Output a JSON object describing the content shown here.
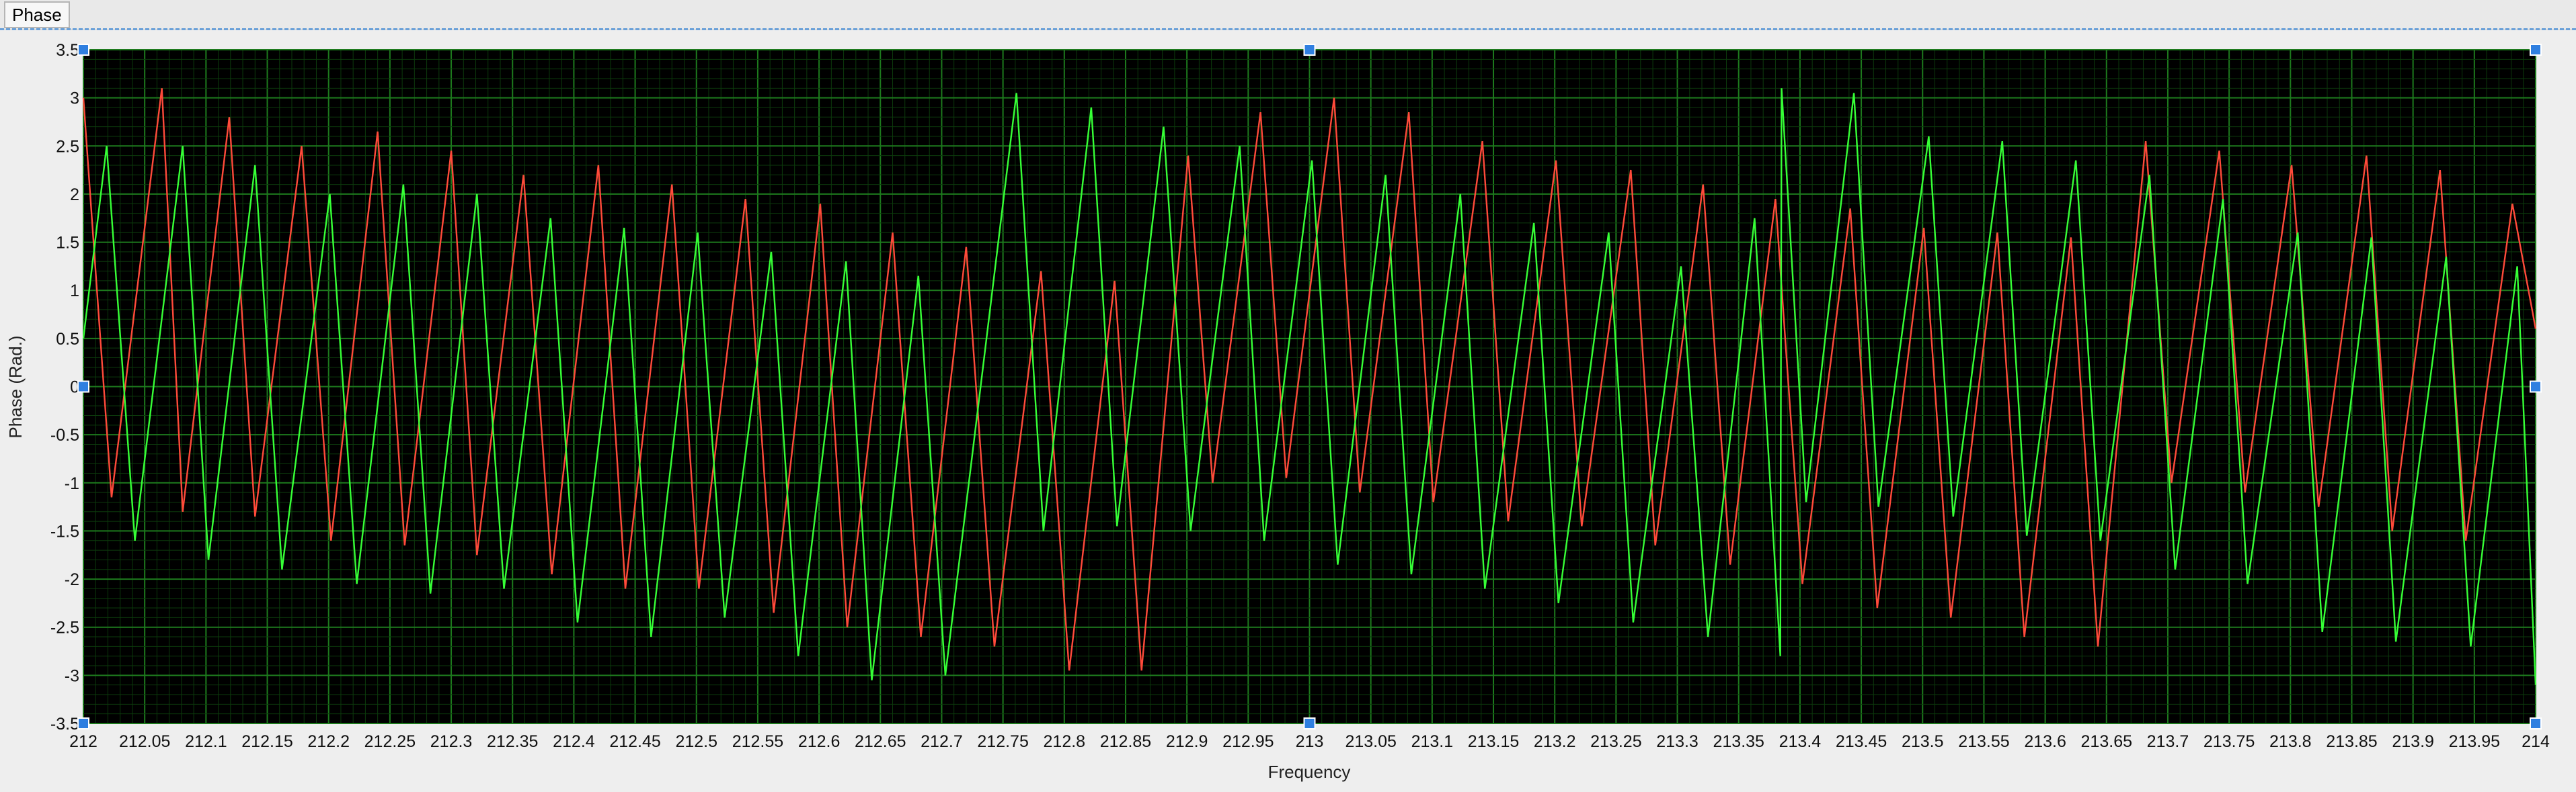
{
  "window": {
    "tab_label": "Phase"
  },
  "colors": {
    "plot_background": "#000000",
    "grid_major": "#1d7a1d",
    "grid_minor": "#0c3a0c"
  },
  "chart_data": {
    "type": "line",
    "title": "",
    "xlabel": "Frequency",
    "ylabel": "Phase (Rad.)",
    "xlim": [
      212,
      214
    ],
    "ylim": [
      -3.5,
      3.5
    ],
    "grid": true,
    "x_ticks": [
      "212",
      "212.05",
      "212.1",
      "212.15",
      "212.2",
      "212.25",
      "212.3",
      "212.35",
      "212.4",
      "212.45",
      "212.5",
      "212.55",
      "212.6",
      "212.65",
      "212.7",
      "212.75",
      "212.8",
      "212.85",
      "212.9",
      "212.95",
      "213",
      "213.05",
      "213.1",
      "213.15",
      "213.2",
      "213.25",
      "213.3",
      "213.35",
      "213.4",
      "213.45",
      "213.5",
      "213.55",
      "213.6",
      "213.65",
      "213.7",
      "213.75",
      "213.8",
      "213.85",
      "213.9",
      "213.95",
      "214"
    ],
    "y_ticks": [
      "3.5",
      "3",
      "2.5",
      "2",
      "1.5",
      "1",
      "0.5",
      "0",
      "-0.5",
      "-1",
      "-1.5",
      "-2",
      "-2.5",
      "-3",
      "-3.5"
    ],
    "series": [
      {
        "color": "#ff4a3a",
        "points": [
          [
            212.0,
            3.0
          ],
          [
            212.023,
            -1.15
          ],
          [
            212.064,
            3.1
          ],
          [
            212.081,
            -1.3
          ],
          [
            212.119,
            2.8
          ],
          [
            212.14,
            -1.35
          ],
          [
            212.178,
            2.5
          ],
          [
            212.202,
            -1.6
          ],
          [
            212.24,
            2.65
          ],
          [
            212.262,
            -1.65
          ],
          [
            212.3,
            2.45
          ],
          [
            212.321,
            -1.75
          ],
          [
            212.359,
            2.2
          ],
          [
            212.382,
            -1.95
          ],
          [
            212.42,
            2.3
          ],
          [
            212.442,
            -2.1
          ],
          [
            212.48,
            2.1
          ],
          [
            212.502,
            -2.1
          ],
          [
            212.54,
            1.95
          ],
          [
            212.563,
            -2.35
          ],
          [
            212.601,
            1.9
          ],
          [
            212.623,
            -2.5
          ],
          [
            212.66,
            1.6
          ],
          [
            212.683,
            -2.6
          ],
          [
            212.72,
            1.45
          ],
          [
            212.743,
            -2.7
          ],
          [
            212.781,
            1.2
          ],
          [
            212.804,
            -2.95
          ],
          [
            212.841,
            1.1
          ],
          [
            212.863,
            -2.95
          ],
          [
            212.901,
            2.4
          ],
          [
            212.921,
            -1.0
          ],
          [
            212.96,
            2.85
          ],
          [
            212.981,
            -0.95
          ],
          [
            213.02,
            3.0
          ],
          [
            213.041,
            -1.1
          ],
          [
            213.081,
            2.85
          ],
          [
            213.101,
            -1.2
          ],
          [
            213.141,
            2.55
          ],
          [
            213.162,
            -1.4
          ],
          [
            213.201,
            2.35
          ],
          [
            213.222,
            -1.45
          ],
          [
            213.262,
            2.25
          ],
          [
            213.282,
            -1.65
          ],
          [
            213.321,
            2.1
          ],
          [
            213.343,
            -1.85
          ],
          [
            213.38,
            1.95
          ],
          [
            213.402,
            -2.05
          ],
          [
            213.441,
            1.85
          ],
          [
            213.463,
            -2.3
          ],
          [
            213.501,
            1.65
          ],
          [
            213.523,
            -2.4
          ],
          [
            213.561,
            1.6
          ],
          [
            213.583,
            -2.6
          ],
          [
            213.621,
            1.55
          ],
          [
            213.643,
            -2.7
          ],
          [
            213.682,
            2.55
          ],
          [
            213.703,
            -1.0
          ],
          [
            213.742,
            2.45
          ],
          [
            213.763,
            -1.1
          ],
          [
            213.801,
            2.3
          ],
          [
            213.823,
            -1.25
          ],
          [
            213.862,
            2.4
          ],
          [
            213.883,
            -1.5
          ],
          [
            213.922,
            2.25
          ],
          [
            213.943,
            -1.6
          ],
          [
            213.981,
            1.9
          ],
          [
            214.0,
            0.6
          ]
        ]
      },
      {
        "color": "#36ff36",
        "points": [
          [
            212.0,
            0.5
          ],
          [
            212.019,
            2.5
          ],
          [
            212.042,
            -1.6
          ],
          [
            212.081,
            2.5
          ],
          [
            212.102,
            -1.8
          ],
          [
            212.14,
            2.3
          ],
          [
            212.162,
            -1.9
          ],
          [
            212.201,
            2.0
          ],
          [
            212.223,
            -2.05
          ],
          [
            212.261,
            2.1
          ],
          [
            212.283,
            -2.15
          ],
          [
            212.321,
            2.0
          ],
          [
            212.343,
            -2.1
          ],
          [
            212.381,
            1.75
          ],
          [
            212.403,
            -2.45
          ],
          [
            212.441,
            1.65
          ],
          [
            212.463,
            -2.6
          ],
          [
            212.501,
            1.6
          ],
          [
            212.523,
            -2.4
          ],
          [
            212.561,
            1.4
          ],
          [
            212.583,
            -2.8
          ],
          [
            212.622,
            1.3
          ],
          [
            212.643,
            -3.05
          ],
          [
            212.681,
            1.15
          ],
          [
            212.703,
            -3.0
          ],
          [
            212.761,
            3.05
          ],
          [
            212.783,
            -1.5
          ],
          [
            212.822,
            2.9
          ],
          [
            212.843,
            -1.45
          ],
          [
            212.881,
            2.7
          ],
          [
            212.903,
            -1.5
          ],
          [
            212.943,
            2.5
          ],
          [
            212.963,
            -1.6
          ],
          [
            213.002,
            2.35
          ],
          [
            213.023,
            -1.85
          ],
          [
            213.062,
            2.2
          ],
          [
            213.083,
            -1.95
          ],
          [
            213.123,
            2.0
          ],
          [
            213.143,
            -2.1
          ],
          [
            213.183,
            1.7
          ],
          [
            213.203,
            -2.25
          ],
          [
            213.244,
            1.6
          ],
          [
            213.264,
            -2.45
          ],
          [
            213.303,
            1.25
          ],
          [
            213.325,
            -2.6
          ],
          [
            213.363,
            1.75
          ],
          [
            213.384,
            -2.8
          ],
          [
            213.385,
            3.1
          ],
          [
            213.405,
            -1.2
          ],
          [
            213.444,
            3.05
          ],
          [
            213.464,
            -1.25
          ],
          [
            213.505,
            2.6
          ],
          [
            213.525,
            -1.35
          ],
          [
            213.565,
            2.55
          ],
          [
            213.585,
            -1.55
          ],
          [
            213.625,
            2.35
          ],
          [
            213.645,
            -1.6
          ],
          [
            213.685,
            2.2
          ],
          [
            213.706,
            -1.9
          ],
          [
            213.745,
            1.95
          ],
          [
            213.765,
            -2.05
          ],
          [
            213.806,
            1.6
          ],
          [
            213.826,
            -2.55
          ],
          [
            213.866,
            1.55
          ],
          [
            213.886,
            -2.65
          ],
          [
            213.927,
            1.35
          ],
          [
            213.947,
            -2.7
          ],
          [
            213.985,
            1.25
          ],
          [
            214.0,
            -3.1
          ]
        ]
      }
    ]
  }
}
